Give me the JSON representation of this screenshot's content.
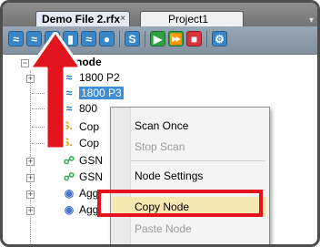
{
  "tabs": [
    {
      "label": "Demo File 2.rfx",
      "close": "×"
    },
    {
      "label": "Project1"
    }
  ],
  "toolbar_icons": [
    "network-icon",
    "wave-icon",
    "wave-icon",
    "device-icon",
    "gauge-icon",
    "globe-icon",
    "scan-icon",
    "play-icon",
    "fast-forward-icon",
    "stop-icon",
    "settings-icon"
  ],
  "tree": {
    "root_label": "Project node",
    "items": [
      {
        "label": "1800 P2",
        "icon": "wave-icon"
      },
      {
        "label": "1800 P3",
        "icon": "wave-icon",
        "selected": true
      },
      {
        "label": "800",
        "icon": "wave-icon"
      },
      {
        "label": "Cop",
        "icon": "scan-s-icon"
      },
      {
        "label": "Cop",
        "icon": "scan-s-icon"
      },
      {
        "label": "GSN",
        "icon": "network-icon"
      },
      {
        "label": "GSN",
        "icon": "network-icon"
      },
      {
        "label": "Agg",
        "icon": "globe-icon"
      },
      {
        "label": "Agg",
        "icon": "globe-icon"
      }
    ]
  },
  "context_menu": {
    "items": [
      {
        "label": "Scan Once",
        "enabled": true
      },
      {
        "label": "Stop Scan",
        "enabled": false
      },
      {
        "label": "Node Settings",
        "enabled": true
      },
      {
        "label": "Copy Node",
        "enabled": true,
        "highlighted": true
      },
      {
        "label": "Paste Node",
        "enabled": false
      }
    ]
  },
  "colors": {
    "annotation": "#e3141d",
    "selection": "#3f8ed8",
    "menu_highlight": "#f7e7b0"
  }
}
